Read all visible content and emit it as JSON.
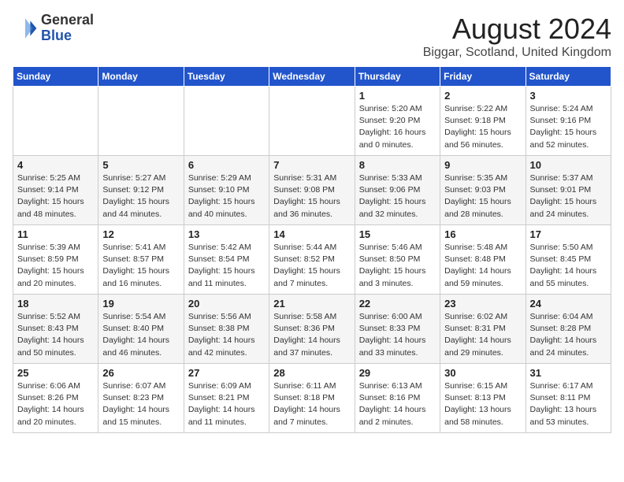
{
  "logo": {
    "general": "General",
    "blue": "Blue"
  },
  "title": {
    "month_year": "August 2024",
    "location": "Biggar, Scotland, United Kingdom"
  },
  "days_of_week": [
    "Sunday",
    "Monday",
    "Tuesday",
    "Wednesday",
    "Thursday",
    "Friday",
    "Saturday"
  ],
  "weeks": [
    [
      {
        "day": "",
        "info": ""
      },
      {
        "day": "",
        "info": ""
      },
      {
        "day": "",
        "info": ""
      },
      {
        "day": "",
        "info": ""
      },
      {
        "day": "1",
        "info": "Sunrise: 5:20 AM\nSunset: 9:20 PM\nDaylight: 16 hours\nand 0 minutes."
      },
      {
        "day": "2",
        "info": "Sunrise: 5:22 AM\nSunset: 9:18 PM\nDaylight: 15 hours\nand 56 minutes."
      },
      {
        "day": "3",
        "info": "Sunrise: 5:24 AM\nSunset: 9:16 PM\nDaylight: 15 hours\nand 52 minutes."
      }
    ],
    [
      {
        "day": "4",
        "info": "Sunrise: 5:25 AM\nSunset: 9:14 PM\nDaylight: 15 hours\nand 48 minutes."
      },
      {
        "day": "5",
        "info": "Sunrise: 5:27 AM\nSunset: 9:12 PM\nDaylight: 15 hours\nand 44 minutes."
      },
      {
        "day": "6",
        "info": "Sunrise: 5:29 AM\nSunset: 9:10 PM\nDaylight: 15 hours\nand 40 minutes."
      },
      {
        "day": "7",
        "info": "Sunrise: 5:31 AM\nSunset: 9:08 PM\nDaylight: 15 hours\nand 36 minutes."
      },
      {
        "day": "8",
        "info": "Sunrise: 5:33 AM\nSunset: 9:06 PM\nDaylight: 15 hours\nand 32 minutes."
      },
      {
        "day": "9",
        "info": "Sunrise: 5:35 AM\nSunset: 9:03 PM\nDaylight: 15 hours\nand 28 minutes."
      },
      {
        "day": "10",
        "info": "Sunrise: 5:37 AM\nSunset: 9:01 PM\nDaylight: 15 hours\nand 24 minutes."
      }
    ],
    [
      {
        "day": "11",
        "info": "Sunrise: 5:39 AM\nSunset: 8:59 PM\nDaylight: 15 hours\nand 20 minutes."
      },
      {
        "day": "12",
        "info": "Sunrise: 5:41 AM\nSunset: 8:57 PM\nDaylight: 15 hours\nand 16 minutes."
      },
      {
        "day": "13",
        "info": "Sunrise: 5:42 AM\nSunset: 8:54 PM\nDaylight: 15 hours\nand 11 minutes."
      },
      {
        "day": "14",
        "info": "Sunrise: 5:44 AM\nSunset: 8:52 PM\nDaylight: 15 hours\nand 7 minutes."
      },
      {
        "day": "15",
        "info": "Sunrise: 5:46 AM\nSunset: 8:50 PM\nDaylight: 15 hours\nand 3 minutes."
      },
      {
        "day": "16",
        "info": "Sunrise: 5:48 AM\nSunset: 8:48 PM\nDaylight: 14 hours\nand 59 minutes."
      },
      {
        "day": "17",
        "info": "Sunrise: 5:50 AM\nSunset: 8:45 PM\nDaylight: 14 hours\nand 55 minutes."
      }
    ],
    [
      {
        "day": "18",
        "info": "Sunrise: 5:52 AM\nSunset: 8:43 PM\nDaylight: 14 hours\nand 50 minutes."
      },
      {
        "day": "19",
        "info": "Sunrise: 5:54 AM\nSunset: 8:40 PM\nDaylight: 14 hours\nand 46 minutes."
      },
      {
        "day": "20",
        "info": "Sunrise: 5:56 AM\nSunset: 8:38 PM\nDaylight: 14 hours\nand 42 minutes."
      },
      {
        "day": "21",
        "info": "Sunrise: 5:58 AM\nSunset: 8:36 PM\nDaylight: 14 hours\nand 37 minutes."
      },
      {
        "day": "22",
        "info": "Sunrise: 6:00 AM\nSunset: 8:33 PM\nDaylight: 14 hours\nand 33 minutes."
      },
      {
        "day": "23",
        "info": "Sunrise: 6:02 AM\nSunset: 8:31 PM\nDaylight: 14 hours\nand 29 minutes."
      },
      {
        "day": "24",
        "info": "Sunrise: 6:04 AM\nSunset: 8:28 PM\nDaylight: 14 hours\nand 24 minutes."
      }
    ],
    [
      {
        "day": "25",
        "info": "Sunrise: 6:06 AM\nSunset: 8:26 PM\nDaylight: 14 hours\nand 20 minutes."
      },
      {
        "day": "26",
        "info": "Sunrise: 6:07 AM\nSunset: 8:23 PM\nDaylight: 14 hours\nand 15 minutes."
      },
      {
        "day": "27",
        "info": "Sunrise: 6:09 AM\nSunset: 8:21 PM\nDaylight: 14 hours\nand 11 minutes."
      },
      {
        "day": "28",
        "info": "Sunrise: 6:11 AM\nSunset: 8:18 PM\nDaylight: 14 hours\nand 7 minutes."
      },
      {
        "day": "29",
        "info": "Sunrise: 6:13 AM\nSunset: 8:16 PM\nDaylight: 14 hours\nand 2 minutes."
      },
      {
        "day": "30",
        "info": "Sunrise: 6:15 AM\nSunset: 8:13 PM\nDaylight: 13 hours\nand 58 minutes."
      },
      {
        "day": "31",
        "info": "Sunrise: 6:17 AM\nSunset: 8:11 PM\nDaylight: 13 hours\nand 53 minutes."
      }
    ]
  ]
}
